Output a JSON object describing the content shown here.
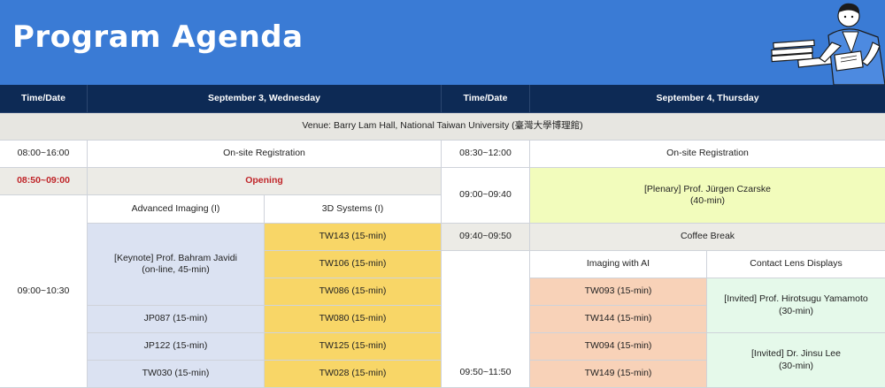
{
  "banner": {
    "title": "Program Agenda"
  },
  "headers": {
    "left_time": "Time/Date",
    "left_date": "September 3, Wednesday",
    "right_time": "Time/Date",
    "right_date": "September 4, Thursday"
  },
  "venue": "Venue: Barry Lam Hall, National Taiwan University (臺灣大學博理館)",
  "day1": {
    "registration_time": "08:00~16:00",
    "registration": "On-site Registration",
    "opening_time": "08:50~09:00",
    "opening": "Opening",
    "session_time": "09:00~10:30",
    "track_a_title": "Advanced Imaging (I)",
    "track_b_title": "3D Systems (I)",
    "track_a": [
      "[Keynote] Prof. Bahram Javidi\n(on-line, 45-min)",
      "JP087 (15-min)",
      "JP122 (15-min)",
      "TW030 (15-min)"
    ],
    "track_b": [
      "TW143 (15-min)",
      "TW106 (15-min)",
      "TW086 (15-min)",
      "TW080 (15-min)",
      "TW125 (15-min)",
      "TW028 (15-min)"
    ]
  },
  "day2": {
    "registration_time": "08:30~12:00",
    "registration": "On-site Registration",
    "plenary_time": "09:00~09:40",
    "plenary": "[Plenary] Prof. Jürgen Czarske\n(40-min)",
    "break_time": "09:40~09:50",
    "break": "Coffee Break",
    "session_time": "09:50~11:50",
    "track_a_title": "Imaging with AI",
    "track_b_title": "Contact Lens Displays",
    "track_a": [
      "TW093 (15-min)",
      "TW144 (15-min)",
      "TW094 (15-min)",
      "TW149 (15-min)"
    ],
    "track_b": [
      "[Invited] Prof. Hirotsugu Yamamoto\n(30-min)",
      "[Invited] Dr. Jinsu Lee\n(30-min)"
    ]
  },
  "colors": {
    "banner": "#3a7bd5",
    "header": "#0d2a55",
    "opening_red": "#c0262a",
    "lavender": "#dbe2f2",
    "yellow": "#f8d667",
    "lime": "#f2fcbc",
    "peach": "#f8d2b8",
    "mint": "#e5f9ea"
  },
  "icons": [
    "person-writing-illustration"
  ]
}
